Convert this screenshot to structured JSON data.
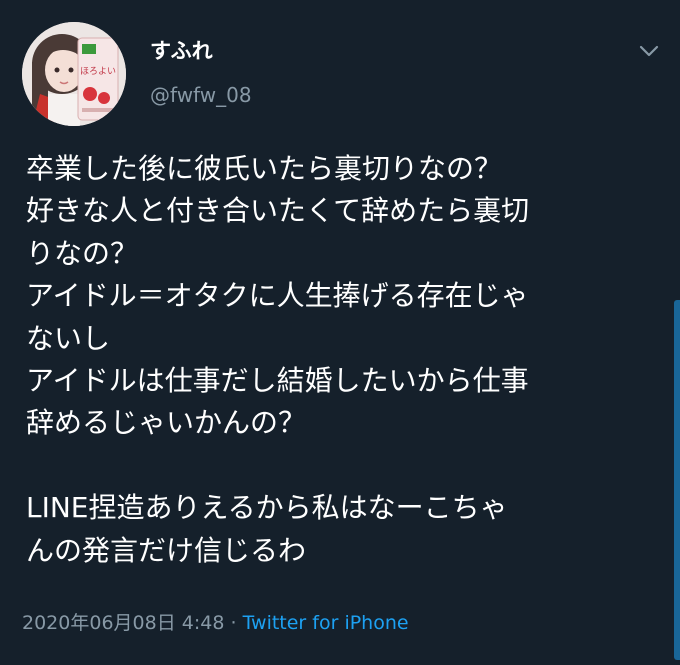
{
  "tweet": {
    "display_name": "すふれ",
    "handle": "@fwfw_08",
    "lines": [
      "卒業した後に彼氏いたら裏切りなの？",
      "好きな人と付き合いたくて辞めたら裏切",
      "りなの？",
      "アイドル＝オタクに人生捧げる存在じゃ",
      "ないし",
      "アイドルは仕事だし結婚したいから仕事",
      "辞めるじゃいかんの？",
      "",
      "LINE捏造ありえるから私はなーこちゃ",
      "んの発言だけ信じるわ"
    ],
    "timestamp": "2020年06月08日 4:48",
    "separator": "·",
    "source": "Twitter for iPhone"
  },
  "avatar": {
    "drink_label": "ほろよい"
  },
  "icons": {
    "caret": "chevron-down-icon"
  },
  "colors": {
    "background": "#15202b",
    "text": "#ffffff",
    "secondary": "#8899a6",
    "accent": "#1da1f2"
  }
}
